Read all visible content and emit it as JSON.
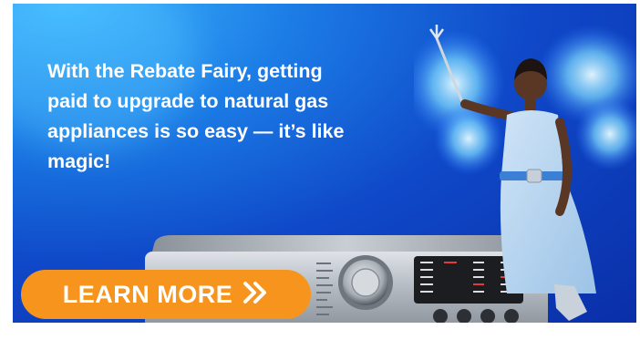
{
  "banner": {
    "headline": "With the Rebate Fairy, getting paid to upgrade to natural gas appliances is so easy — it’s like magic!",
    "cta_label": "LEARN MORE",
    "cta_icon": "double-chevron-right-icon",
    "colors": {
      "background_light": "#3fb8ff",
      "background_dark": "#0a2fa8",
      "cta": "#f7941d",
      "text": "#ffffff"
    }
  }
}
